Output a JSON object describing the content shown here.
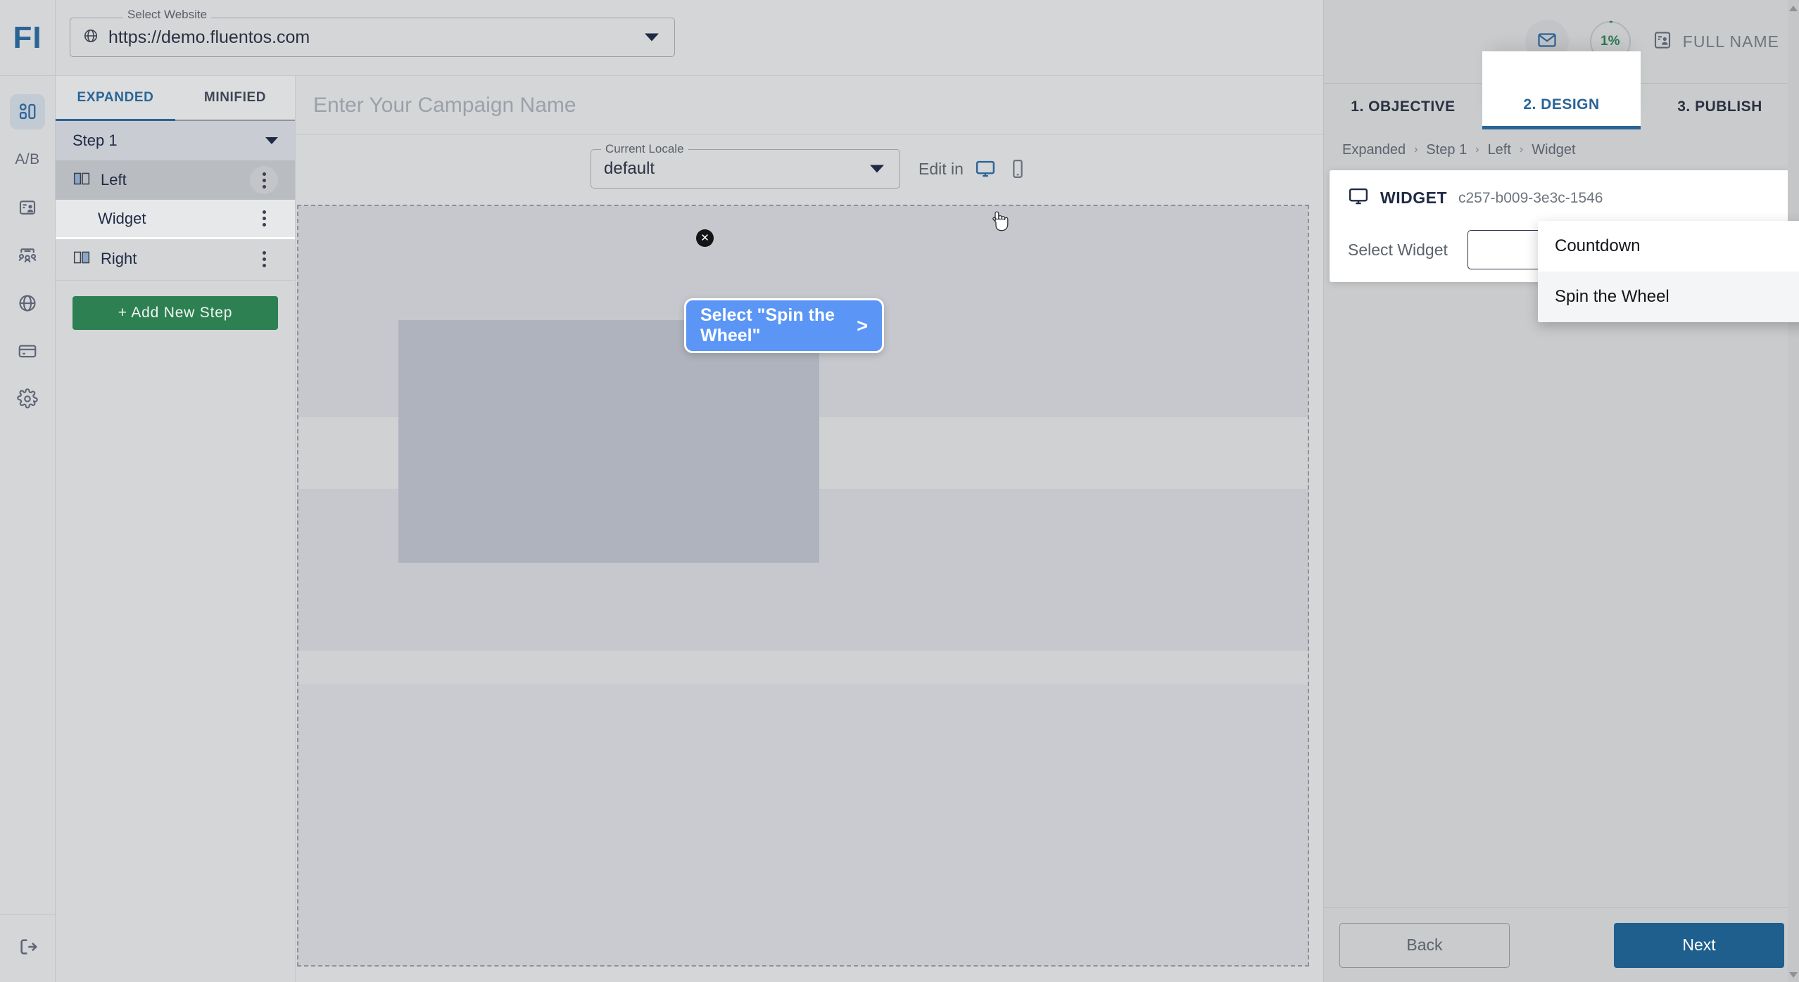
{
  "brand": {
    "logo_text": "FI",
    "accent": "#2a6496",
    "green": "#2d8051",
    "coach_blue": "#5b96f7"
  },
  "rail": {
    "items": [
      {
        "name": "dashboard-icon",
        "label": "",
        "active": true
      },
      {
        "name": "ab-test-icon",
        "label": "A/B",
        "active": false
      },
      {
        "name": "campaign-card-icon",
        "label": "",
        "active": false
      },
      {
        "name": "audience-icon",
        "label": "",
        "active": false
      },
      {
        "name": "globe-icon",
        "label": "",
        "active": false
      },
      {
        "name": "billing-card-icon",
        "label": "",
        "active": false
      },
      {
        "name": "settings-gear-icon",
        "label": "",
        "active": false
      }
    ],
    "logout_icon": "logout-icon"
  },
  "topbar": {
    "website_legend": "Select Website",
    "website_value": "https://demo.fluentos.com",
    "website_icon": "globe-icon",
    "caret_icon": "chevron-down-icon"
  },
  "tree": {
    "tabs": [
      {
        "label": "EXPANDED",
        "active": true
      },
      {
        "label": "MINIFIED",
        "active": false
      }
    ],
    "step_label": "Step 1",
    "rows": [
      {
        "label": "Left",
        "icon": "layout-left-icon",
        "state": "selected-dark",
        "indented": false
      },
      {
        "label": "Widget",
        "icon": "",
        "state": "selected-light",
        "indented": true
      },
      {
        "label": "Right",
        "icon": "layout-right-icon",
        "state": "normal",
        "indented": false
      }
    ],
    "add_step_label": "+ Add New Step"
  },
  "canvas": {
    "campaign_placeholder": "Enter Your Campaign Name",
    "locale_legend": "Current Locale",
    "locale_value": "default",
    "edit_in_label": "Edit in",
    "device_desktop_icon": "monitor-icon",
    "device_mobile_icon": "mobile-icon"
  },
  "right": {
    "header": {
      "mail_icon": "mail-icon",
      "progress_label": "1%",
      "progress_value": 1,
      "profile_icon": "user-card-icon",
      "profile_name": "FULL NAME"
    },
    "tabs": [
      {
        "label": "1. OBJECTIVE",
        "active": false
      },
      {
        "label": "2. DESIGN",
        "active": true
      },
      {
        "label": "3. PUBLISH",
        "active": false
      }
    ],
    "breadcrumb": [
      "Expanded",
      "Step 1",
      "Left",
      "Widget"
    ],
    "breadcrumb_separator": "›",
    "widget_card": {
      "icon": "monitor-icon",
      "title": "WIDGET",
      "id": "c257-b009-3e3c-1546",
      "select_label": "Select Widget",
      "select_value": "",
      "caret_icon": "chevron-up-icon",
      "options": [
        {
          "label": "Countdown",
          "hovered": false
        },
        {
          "label": "Spin the Wheel",
          "hovered": true
        }
      ]
    },
    "footer": {
      "back_label": "Back",
      "next_label": "Next"
    }
  },
  "coachmark": {
    "text": "Select \"Spin the Wheel\"",
    "next_glyph": ">",
    "close_glyph": "✕"
  }
}
